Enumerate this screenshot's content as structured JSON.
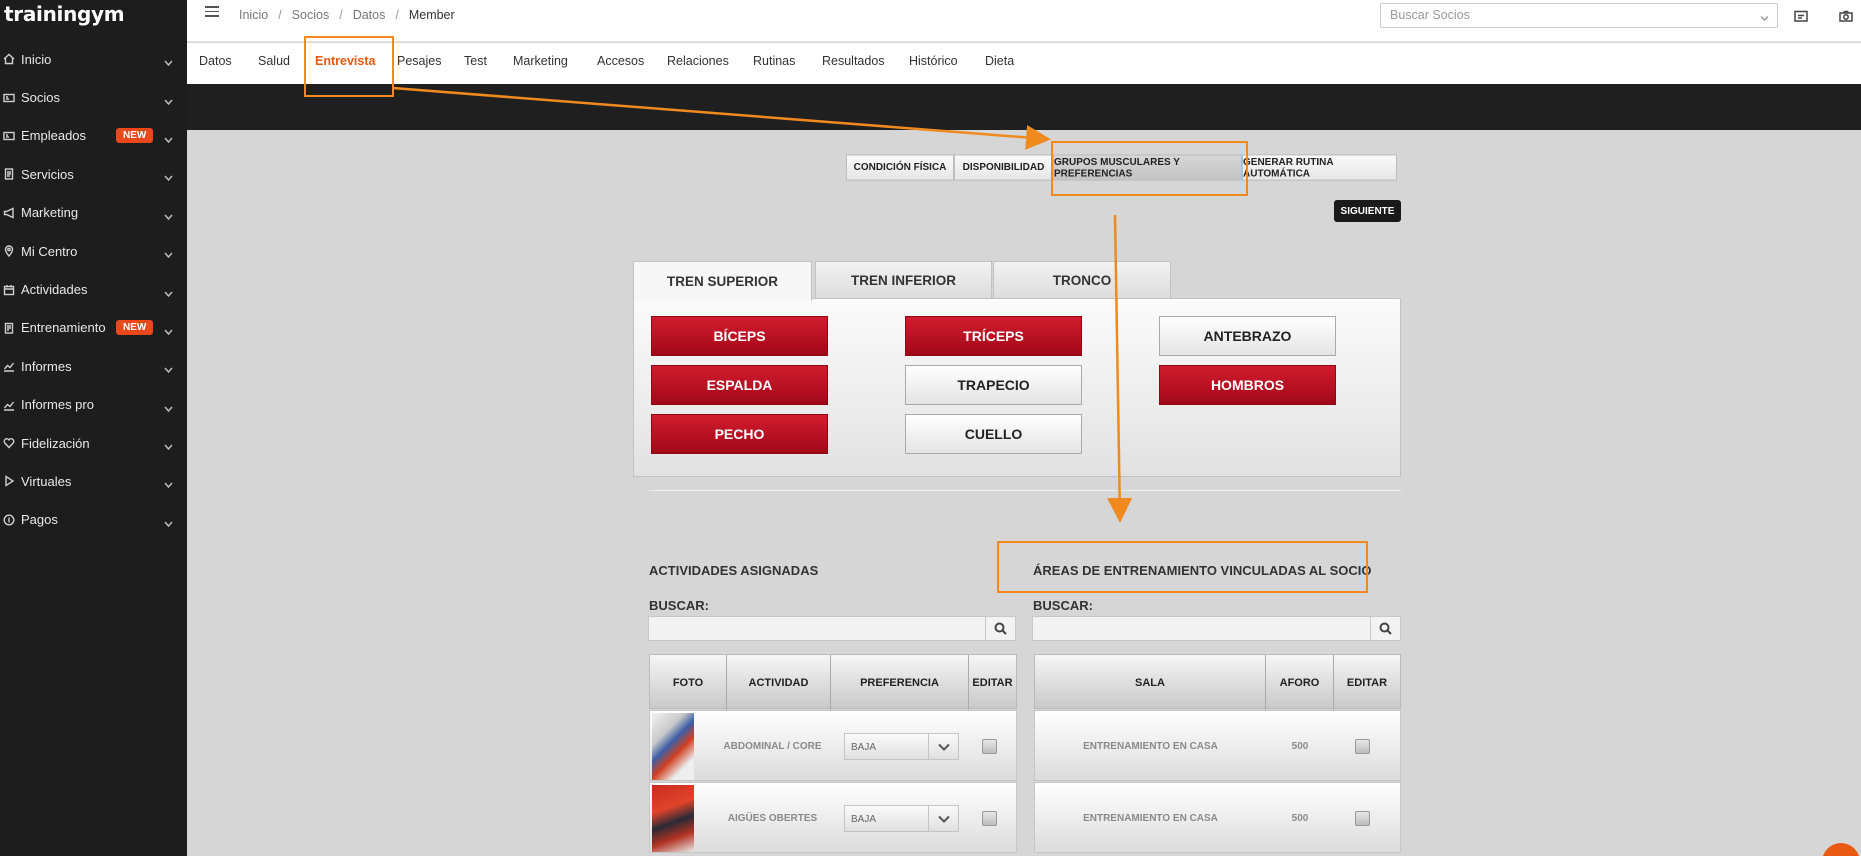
{
  "app": {
    "logo": "trainingym"
  },
  "sidebar": {
    "items": [
      {
        "label": "Inicio",
        "icon": "home-icon"
      },
      {
        "label": "Socios",
        "icon": "id-card-icon"
      },
      {
        "label": "Empleados",
        "icon": "id-card-icon",
        "badge": "NEW"
      },
      {
        "label": "Servicios",
        "icon": "document-icon"
      },
      {
        "label": "Marketing",
        "icon": "megaphone-icon"
      },
      {
        "label": "Mi Centro",
        "icon": "location-pin-icon"
      },
      {
        "label": "Actividades",
        "icon": "calendar-icon"
      },
      {
        "label": "Entrenamiento",
        "icon": "clipboard-icon",
        "badge": "NEW"
      },
      {
        "label": "Informes",
        "icon": "line-chart-icon"
      },
      {
        "label": "Informes pro",
        "icon": "line-chart-icon"
      },
      {
        "label": "Fidelización",
        "icon": "heart-icon"
      },
      {
        "label": "Virtuales",
        "icon": "play-icon"
      },
      {
        "label": "Pagos",
        "icon": "coin-icon"
      }
    ]
  },
  "breadcrumb": [
    "Inicio",
    "Socios",
    "Datos",
    "Member"
  ],
  "search": {
    "placeholder": "Buscar Socios"
  },
  "tabs": [
    "Datos",
    "Salud",
    "Entrevista",
    "Pesajes",
    "Test",
    "Marketing",
    "Accesos",
    "Relaciones",
    "Rutinas",
    "Resultados",
    "Histórico",
    "Dieta"
  ],
  "active_tab": "Entrevista",
  "subtabs": [
    "CONDICIÓN FÍSICA",
    "DISPONIBILIDAD",
    "GRUPOS MUSCULARES Y PREFERENCIAS",
    "GENERAR RUTINA AUTOMÁTICA"
  ],
  "active_subtab": "GRUPOS MUSCULARES Y PREFERENCIAS",
  "next_button": "SIGUIENTE",
  "muscle_tabs": [
    "TREN SUPERIOR",
    "TREN INFERIOR",
    "TRONCO"
  ],
  "muscles": [
    {
      "label": "BÍCEPS",
      "selected": true
    },
    {
      "label": "TRÍCEPS",
      "selected": true
    },
    {
      "label": "ANTEBRAZO",
      "selected": false
    },
    {
      "label": "ESPALDA",
      "selected": true
    },
    {
      "label": "TRAPECIO",
      "selected": false
    },
    {
      "label": "HOMBROS",
      "selected": true
    },
    {
      "label": "PECHO",
      "selected": true
    },
    {
      "label": "CUELLO",
      "selected": false
    }
  ],
  "activities": {
    "title": "ACTIVIDADES ASIGNADAS",
    "search_label": "BUSCAR:",
    "columns": [
      "FOTO",
      "ACTIVIDAD",
      "PREFERENCIA",
      "EDITAR"
    ],
    "rows": [
      {
        "activity": "ABDOMINAL / CORE",
        "preference": "BAJA"
      },
      {
        "activity": "AIGÜES OBERTES",
        "preference": "BAJA"
      }
    ]
  },
  "areas": {
    "title": "ÁREAS DE ENTRENAMIENTO VINCULADAS AL SOCIO",
    "search_label": "BUSCAR:",
    "columns": [
      "SALA",
      "AFORO",
      "EDITAR"
    ],
    "rows": [
      {
        "sala": "ENTRENAMIENTO EN CASA",
        "aforo": "500"
      },
      {
        "sala": "ENTRENAMIENTO EN CASA",
        "aforo": "500"
      }
    ]
  },
  "colors": {
    "accent": "#e85a12",
    "highlight": "#f08a1e",
    "selected_red": "#c0142a"
  }
}
